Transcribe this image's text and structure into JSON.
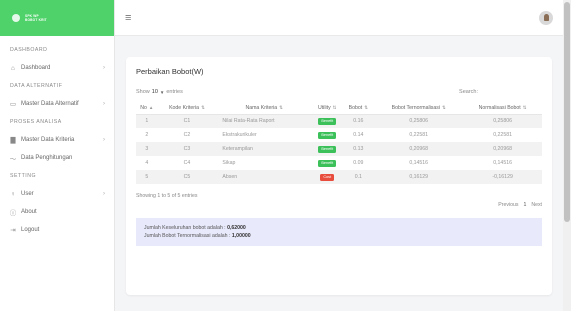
{
  "brand": {
    "line1": "SPK WP",
    "line2": "BOBOT KRIT"
  },
  "sidebar": {
    "items": [
      {
        "type": "head",
        "label": "DASHBOARD"
      },
      {
        "type": "item",
        "label": "Dashboard",
        "icon": "home-icon"
      },
      {
        "type": "head",
        "label": "DATA ALTERNATIF"
      },
      {
        "type": "item",
        "label": "Master Data Alternatif",
        "icon": "folder-icon"
      },
      {
        "type": "head",
        "label": "PROSES ANALISA"
      },
      {
        "type": "item",
        "label": "Master Data Kriteria",
        "icon": "chart-bar-icon"
      },
      {
        "type": "item",
        "label": "Data Penghitungan",
        "icon": "trend-icon"
      },
      {
        "type": "head",
        "label": "SETTING"
      },
      {
        "type": "item",
        "label": "User",
        "icon": "user-icon"
      },
      {
        "type": "item",
        "label": "About",
        "icon": "info-icon"
      },
      {
        "type": "item",
        "label": "Logout",
        "icon": "logout-icon"
      }
    ]
  },
  "card": {
    "title": "Perbaikan Bobot(W)",
    "show_label": "Show",
    "entries_value": "10",
    "entries_label": "entries",
    "search_label": "Search:",
    "columns": [
      "No",
      "Kode Kriteria",
      "Nama Kriteria",
      "Utility",
      "Bobot",
      "Bobot Ternormalisasi",
      "Normalisasi Bobot"
    ],
    "rows": [
      [
        "1",
        "C1",
        "Nilai Rata-Rata Raport",
        "Benefit",
        "0.16",
        "0,25806",
        "0,25806"
      ],
      [
        "2",
        "C2",
        "Ekstrakurikuler",
        "Benefit",
        "0.14",
        "0,22581",
        "0,22581"
      ],
      [
        "3",
        "C3",
        "Keterampilan",
        "Benefit",
        "0.13",
        "0,20968",
        "0,20968"
      ],
      [
        "4",
        "C4",
        "Sikap",
        "Benefit",
        "0.09",
        "0,14516",
        "0,14516"
      ],
      [
        "5",
        "C5",
        "Absen",
        "Cost",
        "0.1",
        "0,16129",
        "-0,16129"
      ]
    ],
    "showing": "Showing 1 to 5 of 5 entries",
    "pager": {
      "prev": "Previous",
      "page": "1",
      "next": "Next"
    },
    "summary": {
      "line1_label": "Jumlah Keseluruhan bobot adalah : ",
      "line1_value": "0,62000",
      "line2_label": "Jumlah Bobot Ternormalisasi adalah : ",
      "line2_value": "1,00000"
    }
  },
  "colors": {
    "brand_green": "#4fd26a",
    "benefit": "#3cc05a",
    "cost": "#e74c3c",
    "summary_bg": "#e8e9fb"
  }
}
